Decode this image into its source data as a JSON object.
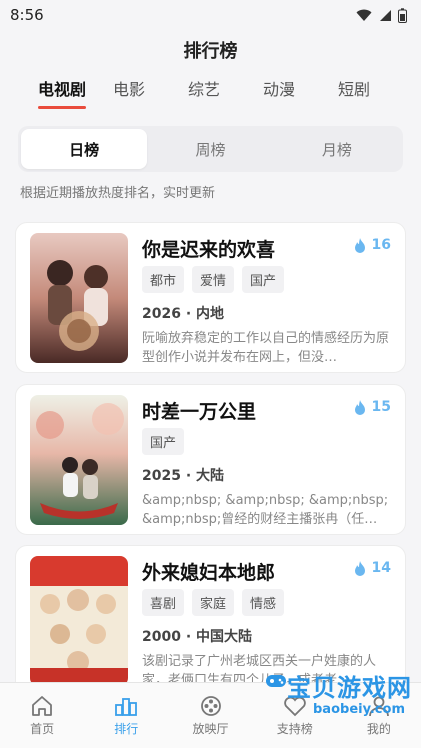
{
  "status": {
    "time": "8:56"
  },
  "header": {
    "title": "排行榜"
  },
  "categories": [
    {
      "label": "电视剧",
      "active": true
    },
    {
      "label": "电影",
      "active": false
    },
    {
      "label": "综艺",
      "active": false
    },
    {
      "label": "动漫",
      "active": false
    },
    {
      "label": "短剧",
      "active": false
    }
  ],
  "periods": [
    {
      "label": "日榜",
      "active": true
    },
    {
      "label": "周榜",
      "active": false
    },
    {
      "label": "月榜",
      "active": false
    }
  ],
  "hint": "根据近期播放热度排名，实时更新",
  "items": [
    {
      "title": "你是迟来的欢喜",
      "rank": "16",
      "tags": [
        "都市",
        "爱情",
        "国产"
      ],
      "meta": "2026 · 内地",
      "desc": "阮喻放弃稳定的工作以自己的情感经历为原型创作小说并发布在网上，但没…"
    },
    {
      "title": "时差一万公里",
      "rank": "15",
      "tags": [
        "国产"
      ],
      "meta": "2025 · 大陆",
      "desc": "&amp;nbsp; &amp;nbsp; &amp;nbsp; &amp;nbsp;曾经的财经主播张冉（任…"
    },
    {
      "title": "外来媳妇本地郎",
      "rank": "14",
      "tags": [
        "喜剧",
        "家庭",
        "情感"
      ],
      "meta": "2000 · 中国大陆",
      "desc": "该剧记录了广州老城区西关一户姓康的人家，老俩口生有四个儿子，成者老…"
    }
  ],
  "nav": [
    {
      "label": "首页",
      "icon": "home-icon",
      "active": false
    },
    {
      "label": "排行",
      "icon": "ranking-icon",
      "active": true
    },
    {
      "label": "放映厅",
      "icon": "film-reel-icon",
      "active": false
    },
    {
      "label": "支持榜",
      "icon": "support-icon",
      "active": false
    },
    {
      "label": "我的",
      "icon": "profile-icon",
      "active": false
    }
  ],
  "watermark": {
    "main": "宝贝游戏网",
    "sub": "baobeiy.com"
  },
  "colors": {
    "accent": "#e94b3c",
    "rank": "#6ab7f0",
    "nav_active": "#3aa0ea"
  }
}
